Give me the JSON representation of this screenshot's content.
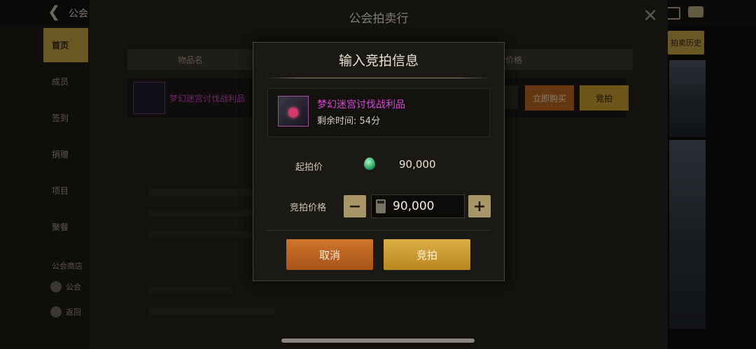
{
  "topbar": {
    "title": "公会",
    "back_icon": "back-arrow-icon",
    "icons": [
      "mail-icon",
      "chat-icon"
    ]
  },
  "sidebar": {
    "items": [
      {
        "label": "首页",
        "active": true
      },
      {
        "label": "成员"
      },
      {
        "label": "签到"
      },
      {
        "label": "捐赠"
      },
      {
        "label": "项目"
      },
      {
        "label": "聚餐"
      }
    ],
    "section_title": "公会商店",
    "sub_items": [
      {
        "label": "公会",
        "icon": "shop-icon"
      },
      {
        "label": "返回",
        "icon": "return-icon"
      }
    ]
  },
  "panel": {
    "title": "公会拍卖行",
    "header": {
      "item_name": "物品名",
      "price": "价格"
    },
    "row": {
      "name": "梦幻迷宫讨伐战利品",
      "buy_now_label": "立即购买",
      "bid_label": "竞拍"
    },
    "history_label": "拍卖历史"
  },
  "modal": {
    "title": "输入竞拍信息",
    "item_name": "梦幻迷宫讨伐战利品",
    "time_label": "剩余时间:",
    "time_value": "54分",
    "start_price_label": "起拍价",
    "start_price_value": "90,000",
    "bid_price_label": "竞拍价格",
    "bid_price_value": "90,000",
    "minus_label": "−",
    "plus_label": "+",
    "cancel_label": "取消",
    "confirm_label": "竞拍"
  },
  "colors": {
    "accent_gold": "#c59a30",
    "accent_orange": "#b8641e",
    "item_purple": "#d944d9"
  }
}
